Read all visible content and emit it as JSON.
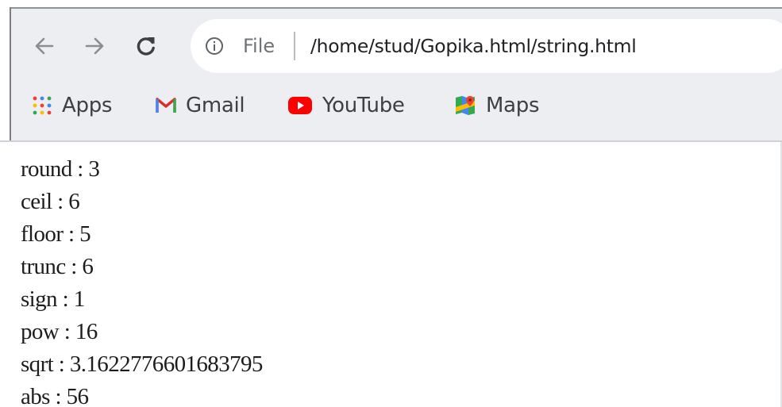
{
  "browser": {
    "address_bar": {
      "scheme_label": "File",
      "url": "/home/stud/Gopika.html/string.html"
    },
    "nav_icons": [
      "back-arrow-icon",
      "forward-arrow-icon",
      "reload-icon",
      "info-icon"
    ],
    "bookmarks": [
      {
        "label": "Apps",
        "icon": "apps-grid-icon"
      },
      {
        "label": "Gmail",
        "icon": "gmail-icon"
      },
      {
        "label": "YouTube",
        "icon": "youtube-icon"
      },
      {
        "label": "Maps",
        "icon": "maps-icon"
      }
    ],
    "colors": {
      "gmail_red": "#d93025",
      "youtube_red": "#ff0000",
      "chrome_bg": "#eceef1"
    }
  },
  "page": {
    "lines": [
      "round : 3",
      "ceil : 6",
      "floor : 5",
      "trunc : 6",
      "sign : 1",
      "pow : 16",
      "sqrt : 3.1622776601683795",
      "abs : 56"
    ]
  }
}
